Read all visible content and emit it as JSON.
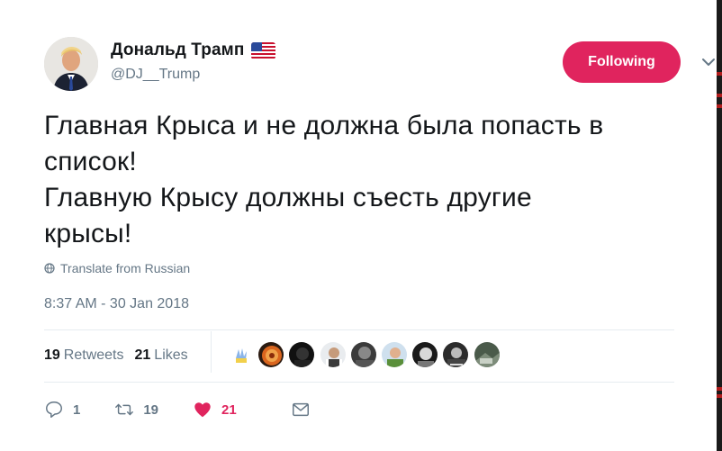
{
  "user": {
    "display_name": "Дональд Трамп",
    "handle": "@DJ__Trump",
    "flag_icon": "us-flag-icon"
  },
  "follow_button": {
    "label": "Following",
    "color": "#e0245e"
  },
  "tweet": {
    "text": "Главная Крыса и не должна была попасть в\nсписок!\nГлавную Крысу должны съесть другие\nкрысы!",
    "translate_label": "Translate from Russian",
    "timestamp": "8:37 AM - 30 Jan 2018"
  },
  "stats": {
    "retweets_count": "19",
    "retweets_label": "Retweets",
    "likes_count": "21",
    "likes_label": "Likes"
  },
  "likers": [
    {
      "name": "liker-avatar-1"
    },
    {
      "name": "liker-avatar-2"
    },
    {
      "name": "liker-avatar-3"
    },
    {
      "name": "liker-avatar-4"
    },
    {
      "name": "liker-avatar-5"
    },
    {
      "name": "liker-avatar-6"
    },
    {
      "name": "liker-avatar-7"
    },
    {
      "name": "liker-avatar-8"
    },
    {
      "name": "liker-avatar-9"
    }
  ],
  "actions": {
    "reply_count": "1",
    "retweet_count": "19",
    "like_count": "21",
    "reply_icon": "reply-icon",
    "retweet_icon": "retweet-icon",
    "like_icon": "heart-icon",
    "dm_icon": "envelope-icon"
  },
  "colors": {
    "like_red": "#e0245e",
    "text": "#14171a",
    "muted": "#657786",
    "divider": "#e6ecf0"
  }
}
